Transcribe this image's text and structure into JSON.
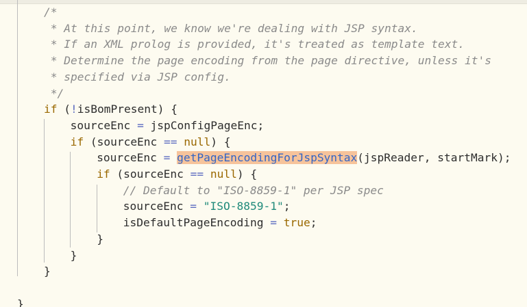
{
  "editor": {
    "lines": [
      {
        "indent": "",
        "parts": [
          {
            "t": "c",
            "v": "/*"
          }
        ]
      },
      {
        "indent": "",
        "parts": [
          {
            "t": "c",
            "v": " * At this point, we know we're dealing with JSP syntax."
          }
        ]
      },
      {
        "indent": "",
        "parts": [
          {
            "t": "c",
            "v": " * If an XML prolog is provided, it's treated as template text."
          }
        ]
      },
      {
        "indent": "",
        "parts": [
          {
            "t": "c",
            "v": " * Determine the page encoding from the page directive, unless it's"
          }
        ]
      },
      {
        "indent": "",
        "parts": [
          {
            "t": "c",
            "v": " * specified via JSP config."
          }
        ]
      },
      {
        "indent": "",
        "parts": [
          {
            "t": "c",
            "v": " */"
          }
        ]
      },
      {
        "indent": "",
        "parts": [
          {
            "t": "kw",
            "v": "if"
          },
          {
            "t": "p",
            "v": " ("
          },
          {
            "t": "op",
            "v": "!"
          },
          {
            "t": "p",
            "v": "isBomPresent) {"
          }
        ]
      },
      {
        "indent": "    ",
        "parts": [
          {
            "t": "p",
            "v": "sourceEnc "
          },
          {
            "t": "op",
            "v": "="
          },
          {
            "t": "p",
            "v": " jspConfigPageEnc;"
          }
        ]
      },
      {
        "indent": "    ",
        "parts": [
          {
            "t": "kw",
            "v": "if"
          },
          {
            "t": "p",
            "v": " (sourceEnc "
          },
          {
            "t": "op",
            "v": "=="
          },
          {
            "t": "p",
            "v": " "
          },
          {
            "t": "kw",
            "v": "null"
          },
          {
            "t": "p",
            "v": ") {"
          }
        ]
      },
      {
        "indent": "        ",
        "parts": [
          {
            "t": "p",
            "v": "sourceEnc "
          },
          {
            "t": "op",
            "v": "="
          },
          {
            "t": "p",
            "v": " "
          },
          {
            "t": "fn",
            "v": "getPageEncodingForJspSyntax"
          },
          {
            "t": "p",
            "v": "(jspReader, startMark);"
          }
        ]
      },
      {
        "indent": "        ",
        "parts": [
          {
            "t": "kw",
            "v": "if"
          },
          {
            "t": "p",
            "v": " (sourceEnc "
          },
          {
            "t": "op",
            "v": "=="
          },
          {
            "t": "p",
            "v": " "
          },
          {
            "t": "kw",
            "v": "null"
          },
          {
            "t": "p",
            "v": ") {"
          }
        ]
      },
      {
        "indent": "            ",
        "parts": [
          {
            "t": "c",
            "v": "// Default to \"ISO-8859-1\" per JSP spec"
          }
        ]
      },
      {
        "indent": "            ",
        "parts": [
          {
            "t": "p",
            "v": "sourceEnc "
          },
          {
            "t": "op",
            "v": "="
          },
          {
            "t": "p",
            "v": " "
          },
          {
            "t": "str",
            "v": "\"ISO-8859-1\""
          },
          {
            "t": "p",
            "v": ";"
          }
        ]
      },
      {
        "indent": "            ",
        "parts": [
          {
            "t": "p",
            "v": "isDefaultPageEncoding "
          },
          {
            "t": "op",
            "v": "="
          },
          {
            "t": "p",
            "v": " "
          },
          {
            "t": "kw",
            "v": "true"
          },
          {
            "t": "p",
            "v": ";"
          }
        ]
      },
      {
        "indent": "        ",
        "parts": [
          {
            "t": "p",
            "v": "}"
          }
        ]
      },
      {
        "indent": "    ",
        "parts": [
          {
            "t": "p",
            "v": "}"
          }
        ]
      },
      {
        "indent": "",
        "parts": [
          {
            "t": "p",
            "v": "}"
          }
        ]
      },
      {
        "indent": "",
        "parts": []
      },
      {
        "indent": "",
        "parts": [
          {
            "t": "p",
            "v": "}"
          }
        ]
      }
    ],
    "colors": {
      "background": "#fdfbf0",
      "comment": "#8a8a8a",
      "keyword": "#9a6800",
      "operator": "#5c6bc0",
      "string": "#1f8a7a",
      "function_highlight_bg": "#f6c39b",
      "function_text": "#3465c4"
    }
  }
}
